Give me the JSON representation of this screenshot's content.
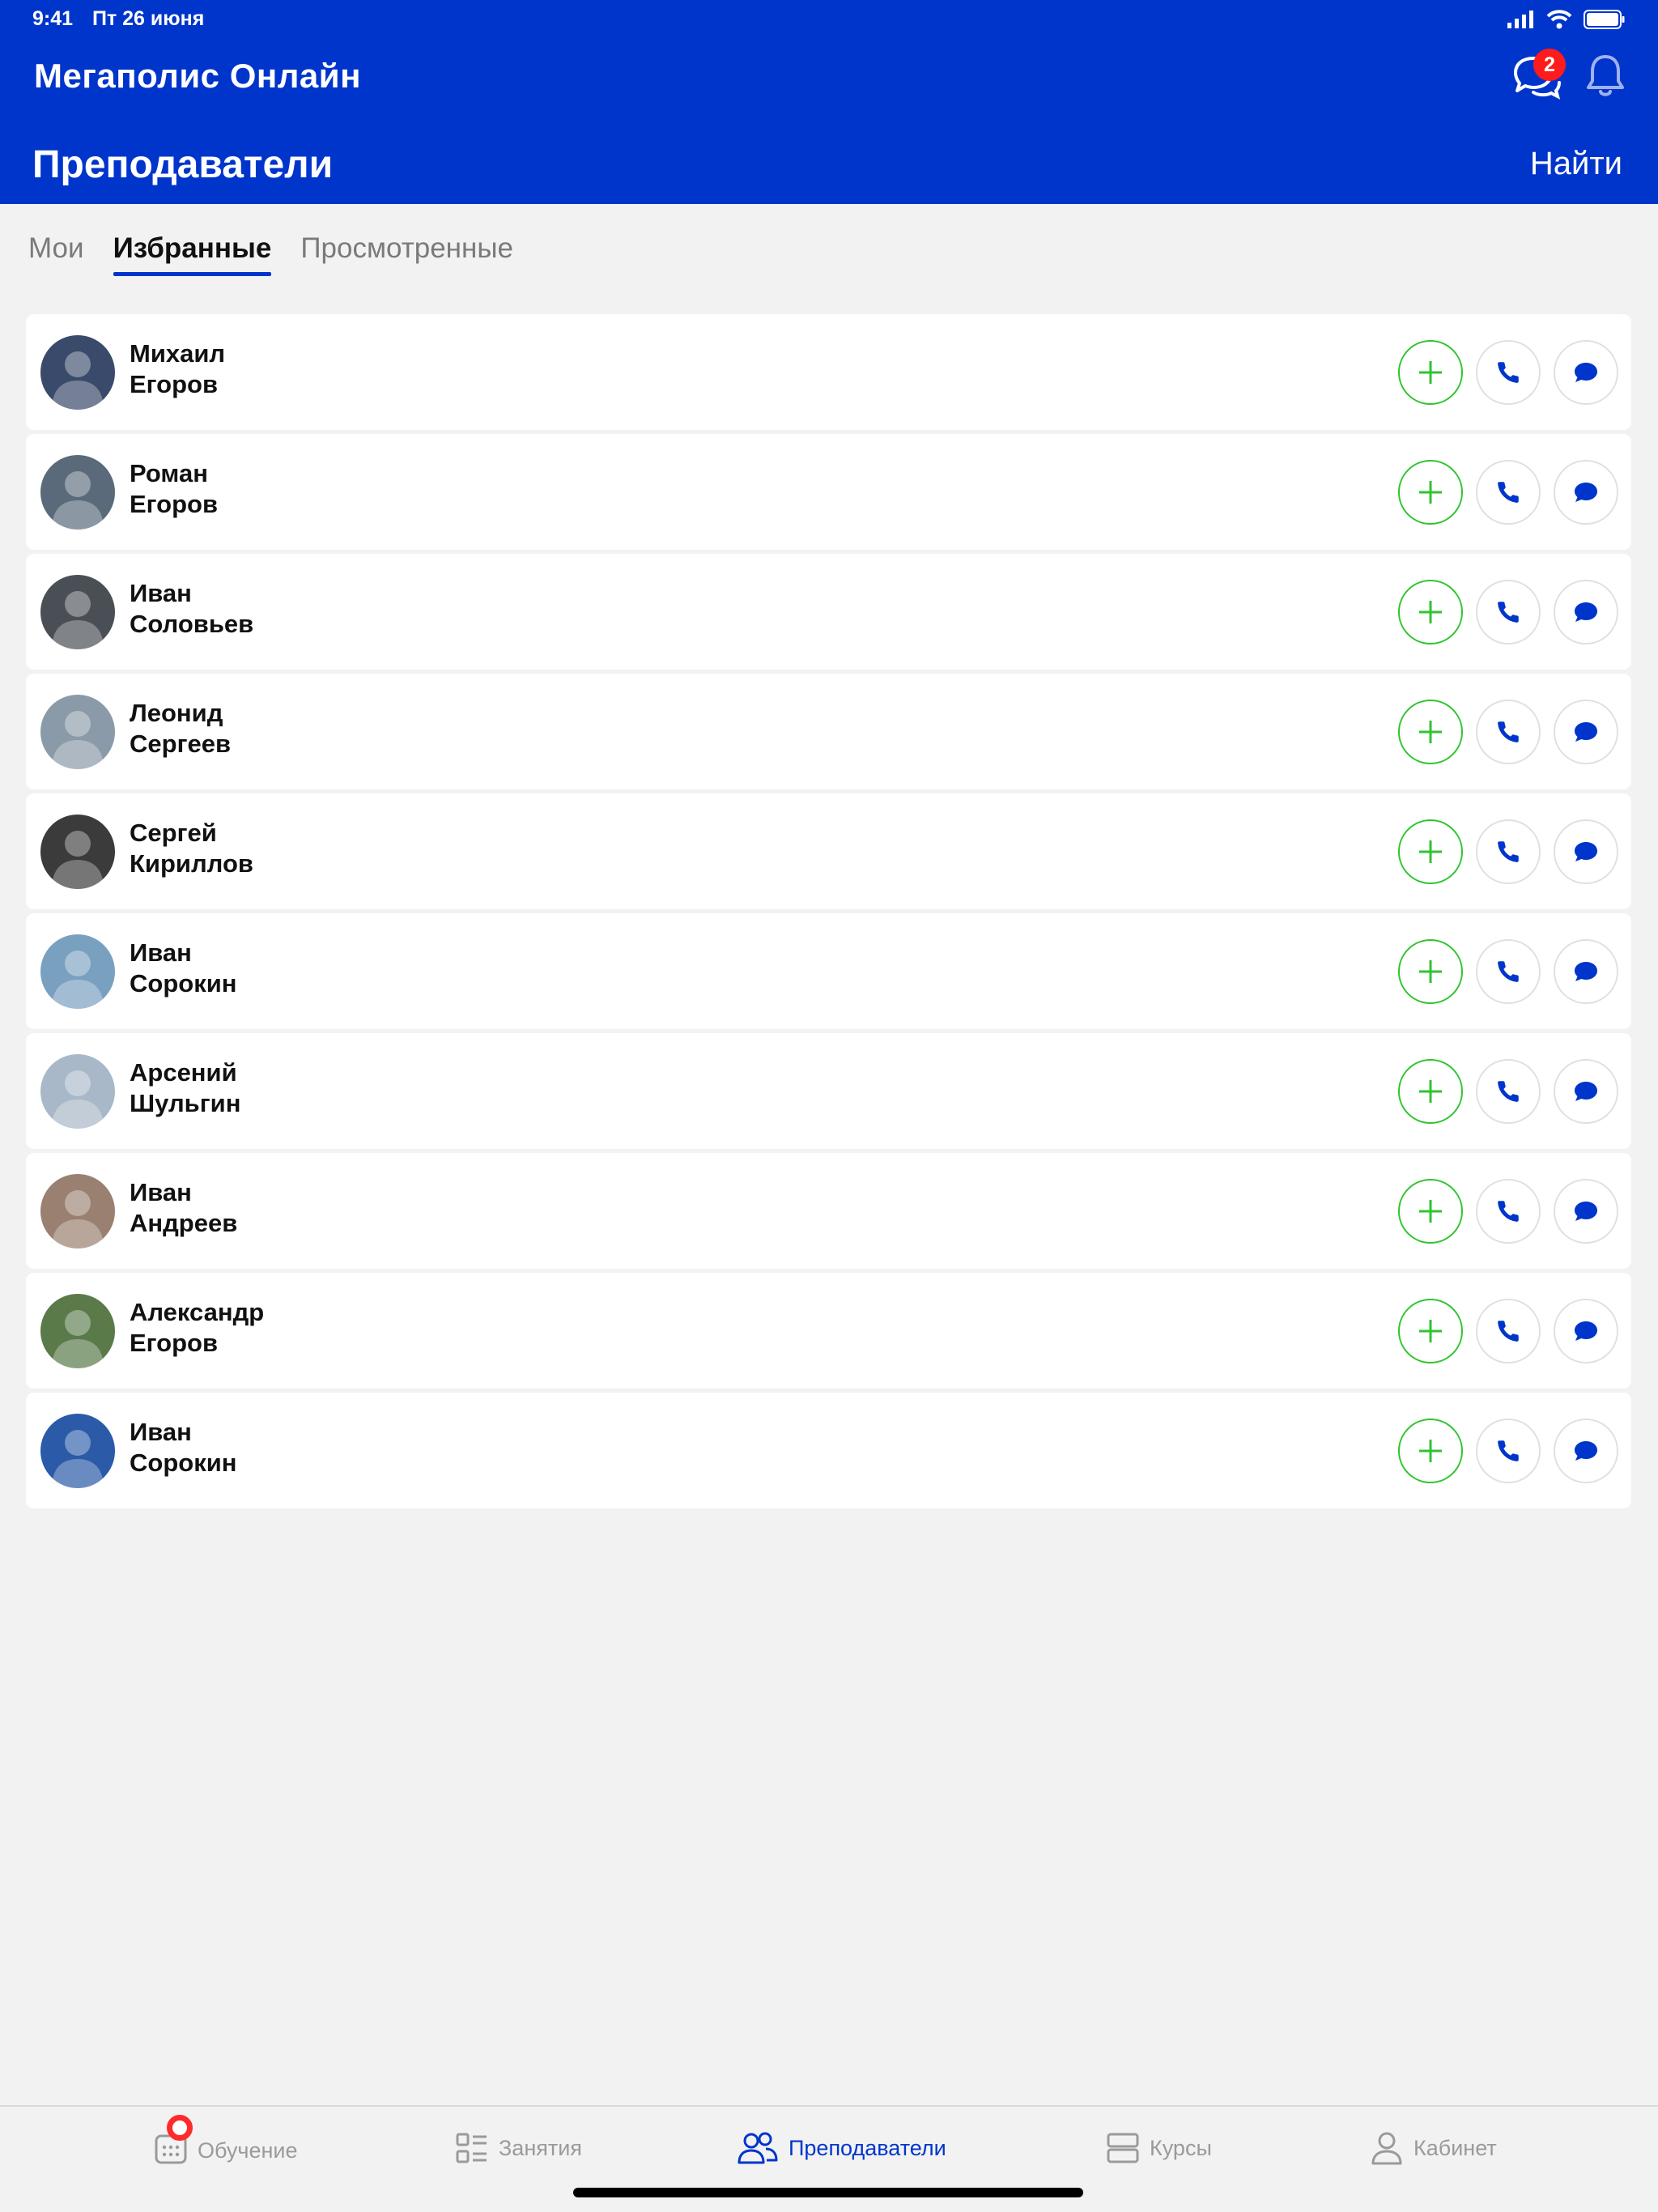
{
  "status": {
    "time": "9:41",
    "date": "Пт 26 июня"
  },
  "header": {
    "app_title": "Мегаполис Онлайн",
    "page_title": "Преподаватели",
    "find": "Найти",
    "chat_badge": "2"
  },
  "tabs": [
    {
      "label": "Мои",
      "active": false
    },
    {
      "label": "Избранные",
      "active": true
    },
    {
      "label": "Просмотренные",
      "active": false
    }
  ],
  "teachers": [
    {
      "first": "Михаил",
      "last": "Егоров",
      "avatar_color": "#3a4a6a"
    },
    {
      "first": "Роман",
      "last": "Егоров",
      "avatar_color": "#5a6a7a"
    },
    {
      "first": "Иван",
      "last": "Соловьев",
      "avatar_color": "#4a4f55"
    },
    {
      "first": "Леонид",
      "last": "Сергеев",
      "avatar_color": "#8a9aa8"
    },
    {
      "first": "Сергей",
      "last": "Кириллов",
      "avatar_color": "#3b3b3b"
    },
    {
      "first": "Иван",
      "last": "Сорокин",
      "avatar_color": "#7aa0c0"
    },
    {
      "first": "Арсений",
      "last": "Шульгин",
      "avatar_color": "#a8b8c8"
    },
    {
      "first": "Иван",
      "last": "Андреев",
      "avatar_color": "#9a8070"
    },
    {
      "first": "Александр",
      "last": "Егоров",
      "avatar_color": "#5a7a4a"
    },
    {
      "first": "Иван",
      "last": "Сорокин",
      "avatar_color": "#2a5aa8"
    }
  ],
  "bottom_nav": [
    {
      "label": "Обучение",
      "icon": "calendar-icon",
      "active": false
    },
    {
      "label": "Занятия",
      "icon": "list-icon",
      "active": false
    },
    {
      "label": "Преподаватели",
      "icon": "people-icon",
      "active": true
    },
    {
      "label": "Курсы",
      "icon": "courses-icon",
      "active": false
    },
    {
      "label": "Кабинет",
      "icon": "user-icon",
      "active": false
    }
  ],
  "colors": {
    "brand": "#0035cc",
    "add": "#2fc52f",
    "badge": "#ff1b1b"
  }
}
